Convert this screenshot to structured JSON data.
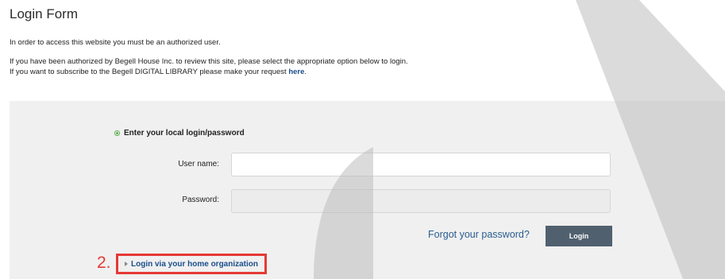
{
  "page": {
    "title": "Login Form",
    "intro": "In order to access this website you must be an authorized user.",
    "authorized_text": "If you have been authorized by Begell House Inc. to review this site, please select the appropriate option below to login.",
    "subscribe_text": "If you want to subscribe to the Begell DIGITAL LIBRARY please make your request ",
    "subscribe_link": "here",
    "subscribe_end": "."
  },
  "login": {
    "option_label": "Enter your local login/password",
    "username_label": "User name:",
    "username_value": "",
    "password_label": "Password:",
    "password_value": "",
    "forgot_link": "Forgot your password?",
    "login_button": "Login"
  },
  "home_org": {
    "step_number": "2.",
    "link_label": "Login via your home organization"
  },
  "colors": {
    "highlight": "#e53935",
    "button": "#51606f",
    "link": "#1a4e8c",
    "panel": "#f0f0f0"
  }
}
